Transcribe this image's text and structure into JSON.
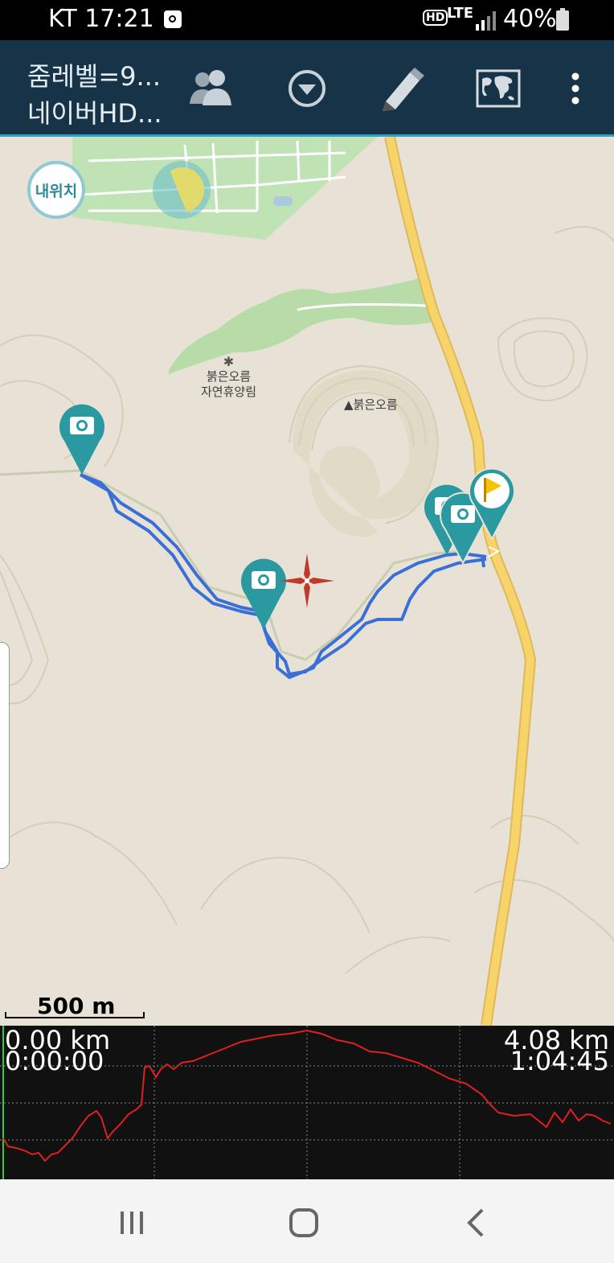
{
  "status_bar": {
    "carrier_time": "KT 17:21",
    "hd_badge": "HD",
    "network": "LTE",
    "battery": "40%"
  },
  "toolbar": {
    "zoom_text": "줌레벨=9...",
    "map_source": "네이버HD...",
    "icons": [
      "group-icon",
      "dropdown-circle-icon",
      "pencil-icon",
      "world-map-icon",
      "more-vertical-icon"
    ]
  },
  "map": {
    "my_location_label": "내위치",
    "places": {
      "forest_name_1": "붉은오름",
      "forest_name_2": "자연휴양림",
      "peak_name": "▲붉은오름"
    },
    "scale_label": "500 m",
    "colors": {
      "track": "#3a6fd8",
      "road": "#f7d46a",
      "pin": "#2a9aa0",
      "flag": "#f5c400",
      "crosshair": "#c0392b"
    }
  },
  "profile": {
    "start_distance": "0.00 km",
    "start_time": "0:00:00",
    "end_distance": "4.08 km",
    "end_time": "1:04:45",
    "line_color": "#e02020"
  },
  "navbar": {
    "icons": [
      "recent-apps-icon",
      "home-icon",
      "back-icon"
    ]
  }
}
